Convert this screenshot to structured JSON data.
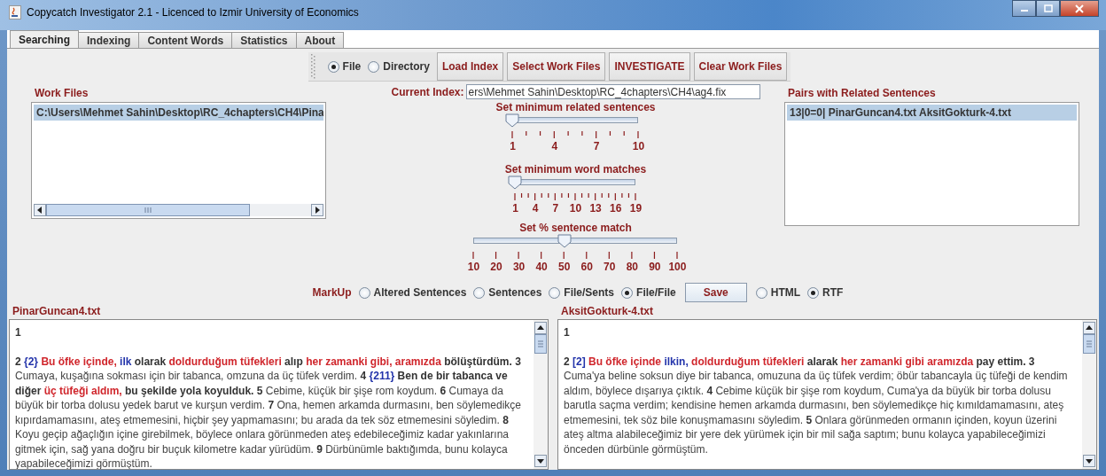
{
  "window": {
    "title": "Copycatch Investigator 2.1 - Licenced to Izmir University of Economics"
  },
  "tabs": [
    {
      "label": "Searching",
      "selected": true
    },
    {
      "label": "Indexing",
      "selected": false
    },
    {
      "label": "Content Words",
      "selected": false
    },
    {
      "label": "Statistics",
      "selected": false
    },
    {
      "label": "About",
      "selected": false
    }
  ],
  "toolbar": {
    "source_options": [
      {
        "label": "File",
        "selected": true
      },
      {
        "label": "Directory",
        "selected": false
      }
    ],
    "buttons": [
      "Load Index",
      "Select Work Files",
      "INVESTIGATE",
      "Clear Work Files"
    ]
  },
  "work_files": {
    "heading": "Work Files",
    "items": [
      {
        "text": "C:\\Users\\Mehmet Sahin\\Desktop\\RC_4chapters\\CH4\\Pina",
        "selected": true
      }
    ]
  },
  "current_index": {
    "label": "Current Index:",
    "value": "ers\\Mehmet Sahin\\Desktop\\RC_4chapters\\CH4\\ag4.fix"
  },
  "sliders": [
    {
      "title": "Set minimum related sentences",
      "level": 0,
      "minor_ticks": true,
      "tick_labels": [
        "1",
        "4",
        "7",
        "10"
      ]
    },
    {
      "title": "Set minimum word matches",
      "level": 0,
      "minor_ticks": true,
      "tick_labels": [
        "1",
        "4",
        "7",
        "10",
        "13",
        "16",
        "19"
      ]
    },
    {
      "title": "Set % sentence match",
      "level": 0.444,
      "minor_ticks": false,
      "tick_labels": [
        "10",
        "20",
        "30",
        "40",
        "50",
        "60",
        "70",
        "80",
        "90",
        "100"
      ]
    }
  ],
  "pairs": {
    "heading": "Pairs with Related Sentences",
    "items": [
      {
        "text": "13|0=0| PinarGuncan4.txt AksitGokturk-4.txt",
        "selected": true
      }
    ]
  },
  "markup": {
    "label": "MarkUp",
    "options": [
      {
        "label": "Altered Sentences",
        "selected": false
      },
      {
        "label": "Sentences",
        "selected": false
      },
      {
        "label": "File/Sents",
        "selected": false
      },
      {
        "label": "File/File",
        "selected": true
      }
    ],
    "save_button": "Save",
    "format_options": [
      {
        "label": "HTML",
        "selected": false
      },
      {
        "label": "RTF",
        "selected": true
      }
    ]
  },
  "documents": [
    {
      "filename": "PinarGuncan4.txt",
      "paragraphs": [
        [
          {
            "text": "1",
            "kind": "bold"
          }
        ],
        [
          {
            "text": "2 ",
            "kind": "bold"
          },
          {
            "text": "{2}  ",
            "kind": "blue"
          },
          {
            "text": "Bu öfke içinde, ",
            "kind": "red"
          },
          {
            "text": "ilk",
            "kind": "blue"
          },
          {
            "text": " olarak ",
            "kind": "bold"
          },
          {
            "text": "doldurduğum tüfekleri",
            "kind": "red"
          },
          {
            "text": " alıp ",
            "kind": "bold"
          },
          {
            "text": "her zamanki gibi, aramızda",
            "kind": "red"
          },
          {
            "text": " bölüştürdüm. 3",
            "kind": "bold"
          },
          {
            "text": " Cumaya, kuşağına sokması için bir tabanca, omzuna da üç tüfek verdim. ",
            "kind": "plain"
          },
          {
            "text": "4 ",
            "kind": "bold"
          },
          {
            "text": "{211}",
            "kind": "blue"
          },
          {
            "text": "  Ben de bir tabanca ve diğer ",
            "kind": "bold"
          },
          {
            "text": "üç tüfeği aldım,",
            "kind": "red"
          },
          {
            "text": " bu şekilde yola koyulduk. 5",
            "kind": "bold"
          },
          {
            "text": " Cebime, küçük bir şişe rom koydum. ",
            "kind": "plain"
          },
          {
            "text": "6",
            "kind": "bold"
          },
          {
            "text": " Cumaya da büyük bir torba dolusu yedek barut ve kurşun verdim. ",
            "kind": "plain"
          },
          {
            "text": "7",
            "kind": "bold"
          },
          {
            "text": " Ona, hemen arkamda durmasını, ben söylemedikçe kıpırdamamasını, ateş etmemesini, hiçbir şey yapmamasını; bu arada da tek söz etmemesini söyledim. ",
            "kind": "plain"
          },
          {
            "text": "8",
            "kind": "bold"
          },
          {
            "text": " Koyu geçip ağaçlığın içine girebilmek, böylece onlara görünmeden ateş edebileceğimiz kadar yakınlarına gitmek için, sağ yana doğru bir buçuk kilometre kadar yürüdüm. ",
            "kind": "plain"
          },
          {
            "text": "9",
            "kind": "bold"
          },
          {
            "text": " Dürbünümle baktığımda, bunu kolayca yapabileceğimizi görmüştüm.",
            "kind": "plain"
          }
        ]
      ]
    },
    {
      "filename": "AksitGokturk-4.txt",
      "paragraphs": [
        [
          {
            "text": "1",
            "kind": "bold"
          }
        ],
        [
          {
            "text": "2 ",
            "kind": "bold"
          },
          {
            "text": "[2]  ",
            "kind": "blue"
          },
          {
            "text": "Bu öfke içinde ",
            "kind": "red"
          },
          {
            "text": "ilkin, ",
            "kind": "blue"
          },
          {
            "text": "doldurduğum tüfekleri",
            "kind": "red"
          },
          {
            "text": " alarak ",
            "kind": "bold"
          },
          {
            "text": "her zamanki gibi aramızda",
            "kind": "red"
          },
          {
            "text": " pay ettim. 3",
            "kind": "bold"
          },
          {
            "text": " Cuma'ya beline soksun diye bir tabanca, omuzuna da üç tüfek verdim; öbür tabancayla üç tüfeği de kendim aldım, böylece dışarıya çıktık. ",
            "kind": "plain"
          },
          {
            "text": "4",
            "kind": "bold"
          },
          {
            "text": " Cebime küçük bir şişe rom koydum, Cuma'ya da büyük bir torba dolusu barutla saçma verdim; kendisine hemen arkamda durmasını, ben söylemedikçe hiç kımıldamamasını, ateş etmemesini, tek söz bile konuşmamasını söyledim. ",
            "kind": "plain"
          },
          {
            "text": "5",
            "kind": "bold"
          },
          {
            "text": " Onlara görünmeden ormanın içinden, koyun üzerini ateş altma alabileceğimiz bir yere dek yürümek için bir mil sağa saptım; bunu kolayca yapabileceğimizi önceden dürbünle görmüştüm.",
            "kind": "plain"
          }
        ]
      ]
    }
  ]
}
